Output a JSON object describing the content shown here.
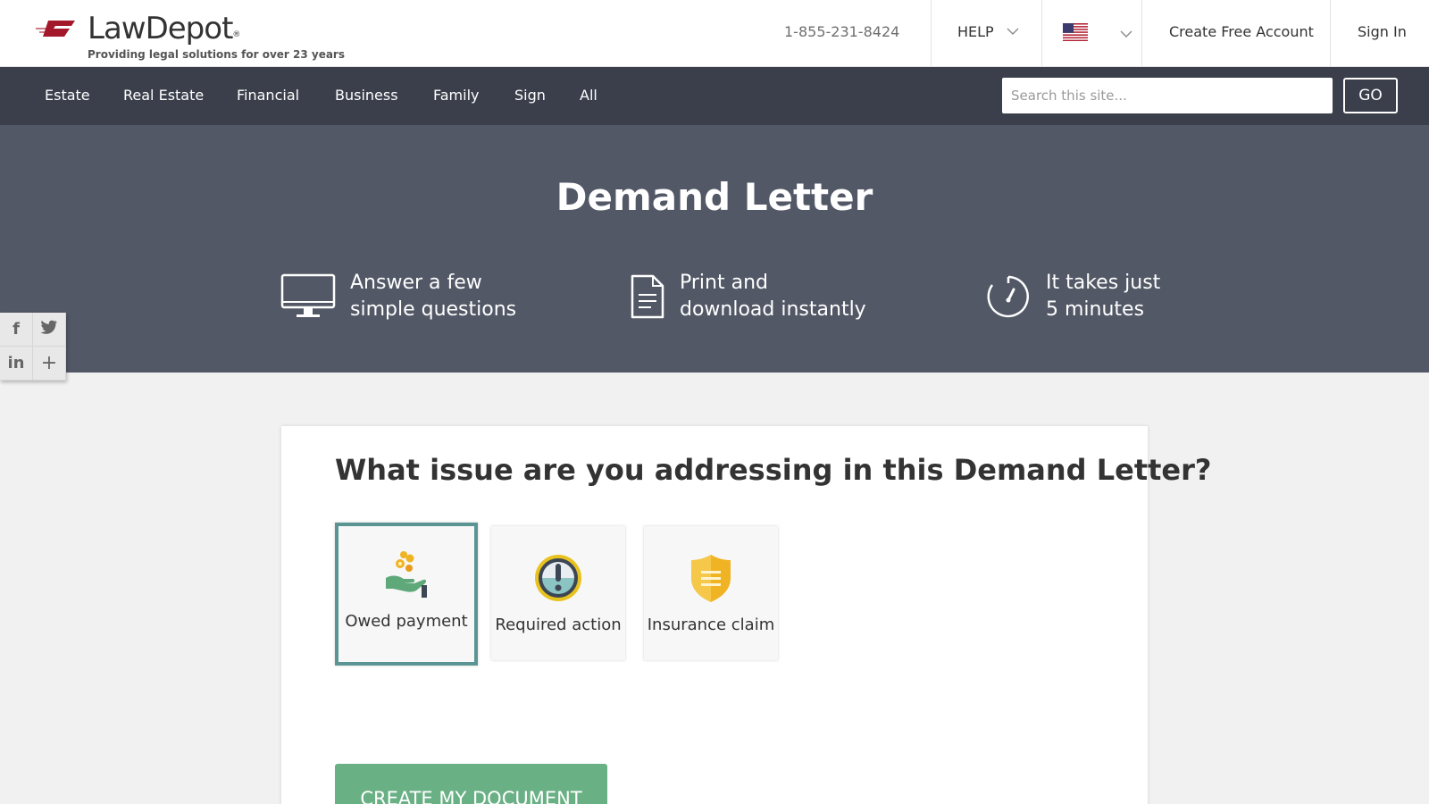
{
  "header": {
    "logo_name": "LawDepot",
    "logo_reg": "®",
    "tagline": "Providing legal solutions for over 23 years",
    "phone": "1-855-231-8424",
    "help_label": "HELP",
    "create_account_label": "Create Free Account",
    "sign_in_label": "Sign In",
    "brand_color": "#a3182b"
  },
  "nav": {
    "items": [
      {
        "label": "Estate"
      },
      {
        "label": "Real Estate"
      },
      {
        "label": "Financial"
      },
      {
        "label": "Business"
      },
      {
        "label": "Family"
      },
      {
        "label": "Sign"
      },
      {
        "label": "All"
      }
    ],
    "search_placeholder": "Search this site...",
    "go_label": "GO"
  },
  "hero": {
    "title": "Demand Letter",
    "features": [
      {
        "icon": "monitor-icon",
        "line1": "Answer a few",
        "line2": "simple questions"
      },
      {
        "icon": "document-icon",
        "line1": "Print and",
        "line2": "download instantly"
      },
      {
        "icon": "stopwatch-icon",
        "line1": "It takes just",
        "line2": "5 minutes"
      }
    ]
  },
  "social": {
    "facebook": "f",
    "linkedin": "in",
    "more": "+"
  },
  "form": {
    "question": "What issue are you addressing in this Demand Letter?",
    "options": [
      {
        "label": "Owed payment",
        "icon": "hand-coins-icon",
        "selected": true
      },
      {
        "label": "Required action",
        "icon": "exclamation-icon",
        "selected": false
      },
      {
        "label": "Insurance claim",
        "icon": "shield-icon",
        "selected": false
      }
    ],
    "cta_label": "CREATE MY DOCUMENT",
    "selected_border_color": "#5a9594",
    "cta_color": "#6ab085"
  }
}
